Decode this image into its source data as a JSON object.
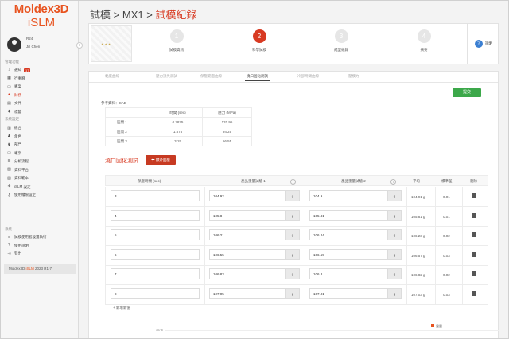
{
  "brand": {
    "line1": "Moldex3D",
    "line2": "iSLM"
  },
  "user": {
    "id": "R24",
    "name": "Jill Chen"
  },
  "sidebar": {
    "section1": "管理功能",
    "items1": [
      {
        "label": "通知",
        "badge": "17",
        "icon": "bell-icon"
      },
      {
        "label": "行事曆",
        "icon": "calendar-icon"
      },
      {
        "label": "專案",
        "icon": "folder-icon"
      },
      {
        "label": "財務",
        "icon": "alert-icon",
        "active": true
      },
      {
        "label": "文件",
        "icon": "doc-icon"
      },
      {
        "label": "標籤",
        "icon": "tag-icon"
      }
    ],
    "section2": "系統設定",
    "items2": [
      {
        "label": "機台",
        "icon": "machine-icon"
      },
      {
        "label": "角色",
        "icon": "user-icon"
      },
      {
        "label": "部門",
        "icon": "group-icon"
      },
      {
        "label": "專案",
        "icon": "folder-icon"
      },
      {
        "label": "分析流程",
        "icon": "flow-icon"
      },
      {
        "label": "資料平台",
        "icon": "data-icon"
      },
      {
        "label": "資料範本",
        "icon": "template-icon"
      },
      {
        "label": "iSLM 設定",
        "icon": "gear-icon"
      },
      {
        "label": "使用權限設定",
        "icon": "key-icon"
      }
    ],
    "section3": "系統",
    "items3": [
      {
        "label": "試模使用者設置執行",
        "icon": "list-icon"
      },
      {
        "label": "使用說明",
        "icon": "help-icon"
      },
      {
        "label": "登出",
        "icon": "logout-icon"
      }
    ],
    "version": {
      "prefix": "Moldex3D ",
      "product": "iSLM",
      "suffix": " 2023 R1-7"
    }
  },
  "header": {
    "crumb1": "試模",
    "sep": ">",
    "crumb2": "MX1",
    "crumb3": "試模紀錄"
  },
  "steps": [
    {
      "num": "1",
      "label": "試模資訊"
    },
    {
      "num": "2",
      "label": "科學試模"
    },
    {
      "num": "3",
      "label": "成型紀錄"
    },
    {
      "num": "4",
      "label": "摘要"
    }
  ],
  "help_label": "說明",
  "tabs": [
    "黏度曲線",
    "壓力損失測試",
    "保壓範圍曲線",
    "澆口固化測試",
    "冷卻時間曲線",
    "壓模力"
  ],
  "active_tab": 3,
  "submit_label": "提交",
  "reference": {
    "label": "參考資料：CAE",
    "headers": [
      "",
      "時間 (sec)",
      "壓力 (MPa)"
    ],
    "rows": [
      [
        "區間 1",
        "0.7875",
        "131.95"
      ],
      [
        "區間 2",
        "1.575",
        "94.25"
      ],
      [
        "區間 3",
        "3.15",
        "56.55"
      ]
    ]
  },
  "section": {
    "title": "澆口固化測試",
    "add_label": "額外面壓"
  },
  "table": {
    "headers": {
      "time": "保壓時間 (sec)",
      "w1": "產品重量試驗 1",
      "w2": "產品重量試驗 2",
      "avg": "平均",
      "std": "標準差",
      "del": "刪除"
    },
    "unit": "g",
    "rows": [
      {
        "time": "3",
        "w1": "104.92",
        "w2": "104.9",
        "avg": "104.91 g",
        "std": "0.01"
      },
      {
        "time": "4",
        "w1": "105.8",
        "w2": "105.81",
        "avg": "105.81 g",
        "std": "0.01"
      },
      {
        "time": "5",
        "w1": "106.21",
        "w2": "106.24",
        "avg": "106.23 g",
        "std": "0.02"
      },
      {
        "time": "6",
        "w1": "106.55",
        "w2": "106.59",
        "avg": "106.57 g",
        "std": "0.03"
      },
      {
        "time": "7",
        "w1": "106.83",
        "w2": "106.8",
        "avg": "106.82 g",
        "std": "0.02"
      },
      {
        "time": "8",
        "w1": "107.05",
        "w2": "107.01",
        "avg": "107.03 g",
        "std": "0.03"
      }
    ],
    "add_row": "新增新值"
  },
  "chart": {
    "legend": "重量",
    "ytick": "107.5"
  },
  "colors": {
    "accent": "#d83a22",
    "brand": "#e8531f",
    "submit": "#3ca84a",
    "help": "#3b7fd2"
  }
}
